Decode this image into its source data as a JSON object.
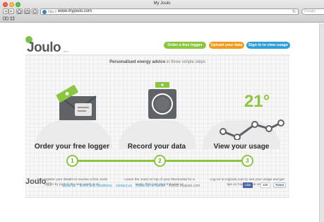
{
  "browser": {
    "title": "My Joulo",
    "url_prefix": "http://",
    "url": "www.myjoulo.com",
    "reload_icon": "reload-icon",
    "search_placeholder": "Google",
    "nav_back": "◂",
    "nav_forward": "▸",
    "bookmarks_icon": "bookmarks-icon",
    "grid_icon": "top-sites-icon"
  },
  "site": {
    "logo": "Joulo",
    "logo_mark": "",
    "logo_beta": "BETA",
    "buttons": {
      "order": "Order a free logger",
      "upload": "Upload your data",
      "signin": "Sign in to view usage"
    },
    "tagline_bold": "Personalised energy advice",
    "tagline_rest": " in three simple steps",
    "steps": [
      {
        "number": "1",
        "title": "Order your free logger",
        "desc": "Just register your details to receive a free Joulo logger by post in the next week or so"
      },
      {
        "number": "2",
        "title": "Record your data",
        "desc": "Leave the Joulo on top of your thermostat for a week, then just plug it to your pc"
      },
      {
        "number": "3",
        "title": "View your usage",
        "desc": "Log-on to myjoulo.com to see your usage and get tips on how to save energy"
      }
    ],
    "temperature": "21°",
    "footer": {
      "logo": "Joulo",
      "logo_tm": "BETA",
      "links": [
        "about us",
        "terms and conditions",
        "contact us",
        "follow us on twitter"
      ],
      "copyright": "©2012 myjoulo.com",
      "like": "Like",
      "like_count": "106",
      "tweet": "Tweet"
    }
  },
  "colors": {
    "green": "#8cc63f",
    "orange": "#f29b1d",
    "blue": "#2f9fd8"
  }
}
